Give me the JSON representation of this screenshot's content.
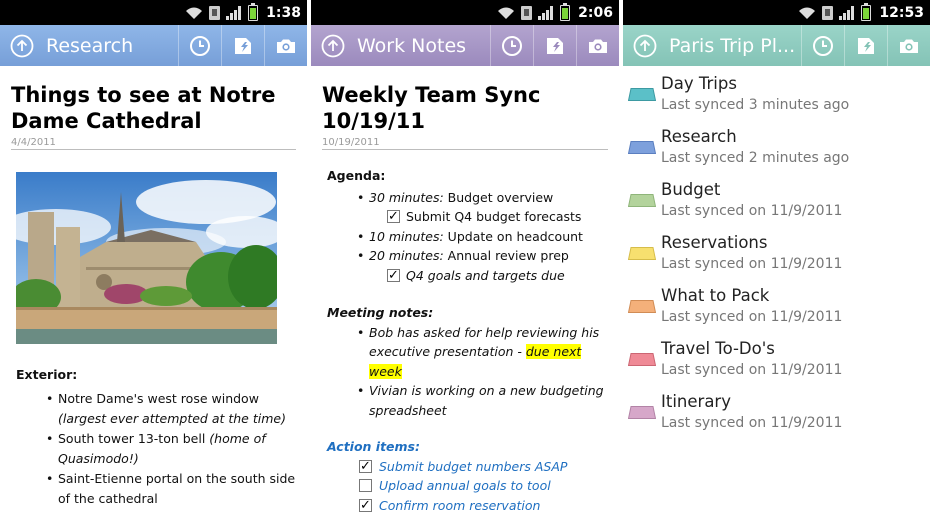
{
  "colors": {
    "research_tab": "#779fd8",
    "work_tab": "#9b8abd",
    "paris_tab": "#84c3b6",
    "action_blue": "#1f6fc1",
    "highlight": "#ffff00"
  },
  "screens": [
    {
      "status_time": "1:38",
      "title": "Research",
      "page_title": "Things to see at Notre Dame Cathedral",
      "page_date": "4/4/2011",
      "section_label": "Exterior:",
      "bullets": [
        {
          "text": "Notre Dame's west rose window ",
          "italic": "(largest ever attempted at the time)"
        },
        {
          "text": "South tower 13-ton bell ",
          "italic": "(home of Quasimodo!)"
        },
        {
          "text": "Saint-Etienne portal on the south side of the cathedral",
          "italic": ""
        }
      ]
    },
    {
      "status_time": "2:06",
      "title": "Work Notes",
      "page_title": "Weekly Team Sync 10/19/11",
      "page_date": "10/19/2011",
      "agenda_label": "Agenda:",
      "agenda": [
        {
          "italic": "30 minutes:",
          "text": " Budget overview"
        },
        {
          "checkbox": "Submit Q4 budget forecasts",
          "checked": true
        },
        {
          "italic": "10 minutes:",
          "text": " Update on headcount"
        },
        {
          "italic": "20 minutes:",
          "text": " Annual review prep"
        },
        {
          "checkbox_italic": "Q4 goals and targets due",
          "checked": true
        }
      ],
      "meeting_label": "Meeting notes:",
      "meeting_notes": [
        {
          "text": "Bob has asked for help reviewing his executive presentation - ",
          "highlight": "due next week"
        },
        {
          "text": "Vivian is working on a new budgeting spreadsheet",
          "highlight": ""
        }
      ],
      "action_label": "Action items:",
      "action_items": [
        {
          "text": "Submit budget numbers ASAP",
          "checked": true
        },
        {
          "text": "Upload annual goals to tool",
          "checked": false
        },
        {
          "text": "Confirm room reservation",
          "checked": true
        }
      ]
    },
    {
      "status_time": "12:53",
      "title": "Paris Trip Pl...",
      "sections": [
        {
          "name": "Day Trips",
          "sync": "Last synced 3 minutes ago",
          "color": "#5bc0c8"
        },
        {
          "name": "Research",
          "sync": "Last synced 2 minutes ago",
          "color": "#7da0dc"
        },
        {
          "name": "Budget",
          "sync": "Last synced on 11/9/2011",
          "color": "#b3d39c"
        },
        {
          "name": "Reservations",
          "sync": "Last synced on 11/9/2011",
          "color": "#f7e06f"
        },
        {
          "name": "What to Pack",
          "sync": "Last synced on 11/9/2011",
          "color": "#f4b07a"
        },
        {
          "name": "Travel To-Do's",
          "sync": "Last synced on 11/9/2011",
          "color": "#ef8a96"
        },
        {
          "name": "Itinerary",
          "sync": "Last synced on 11/9/2011",
          "color": "#d6a7c9"
        }
      ]
    }
  ]
}
